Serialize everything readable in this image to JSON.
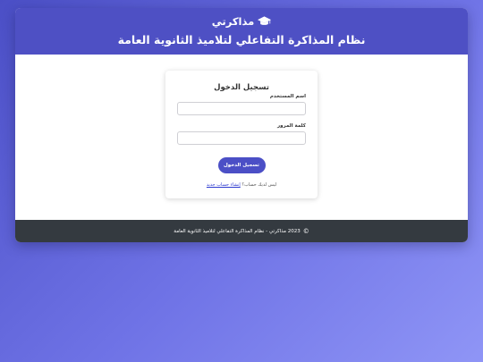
{
  "header": {
    "brand": "مذاكرتي",
    "brand_icon": "graduation-cap-icon",
    "subtitle": "نظام المذاكرة التفاعلي لتلاميذ الثانوية العامة"
  },
  "login": {
    "title": "تسجيل الدخول",
    "username_label": "اسم المستخدم",
    "username_value": "",
    "password_label": "كلمة المرور",
    "password_value": "",
    "submit_label": "تسجيل الدخول",
    "register_prompt": "ليس لديك حساب؟",
    "register_link": "إنشاء حساب جديد"
  },
  "footer": {
    "copyright_symbol": "©",
    "text": "2023 مذاكرتي - نظام المذاكرة التفاعلي لتلاميذ الثانوية العامة"
  },
  "colors": {
    "header_bg": "#4e50c4",
    "button_bg": "#4b4fc6",
    "footer_bg": "#343a40",
    "link": "#2d3ad0"
  }
}
